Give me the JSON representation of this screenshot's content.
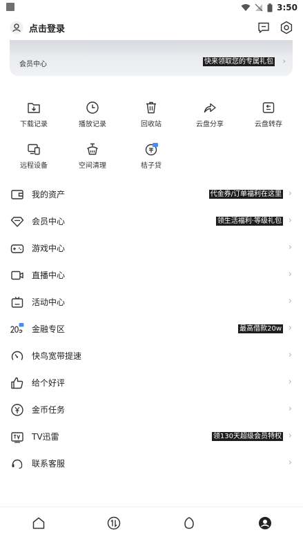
{
  "status": {
    "time": "3:50"
  },
  "header": {
    "login_label": "点击登录"
  },
  "vip_card": {
    "label": "会员中心",
    "promo": "快来领取您的专属礼包"
  },
  "grid": [
    {
      "label": "下载记录",
      "icon": "download-record-icon"
    },
    {
      "label": "播放记录",
      "icon": "play-history-icon"
    },
    {
      "label": "回收站",
      "icon": "recycle-bin-icon"
    },
    {
      "label": "云盘分享",
      "icon": "cloud-share-icon"
    },
    {
      "label": "云盘转存",
      "icon": "cloud-transfer-icon"
    },
    {
      "label": "远程设备",
      "icon": "remote-device-icon"
    },
    {
      "label": "空间清理",
      "icon": "space-clean-icon"
    },
    {
      "label": "桔子贷",
      "icon": "juzi-loan-icon"
    }
  ],
  "menu": [
    {
      "label": "我的资产",
      "promo": "代金券/订单福利在这里"
    },
    {
      "label": "会员中心",
      "promo": "领生活福利·等级礼包"
    },
    {
      "label": "游戏中心",
      "promo": ""
    },
    {
      "label": "直播中心",
      "promo": ""
    },
    {
      "label": "活动中心",
      "promo": ""
    },
    {
      "label": "金融专区",
      "promo": "最高借款20w"
    },
    {
      "label": "快鸟宽带提速",
      "promo": ""
    },
    {
      "label": "给个好评",
      "promo": ""
    },
    {
      "label": "金币任务",
      "promo": ""
    },
    {
      "label": "TV迅雷",
      "promo": "领130天超级会员特权"
    },
    {
      "label": "联系客服",
      "promo": ""
    }
  ],
  "chevron": "›"
}
